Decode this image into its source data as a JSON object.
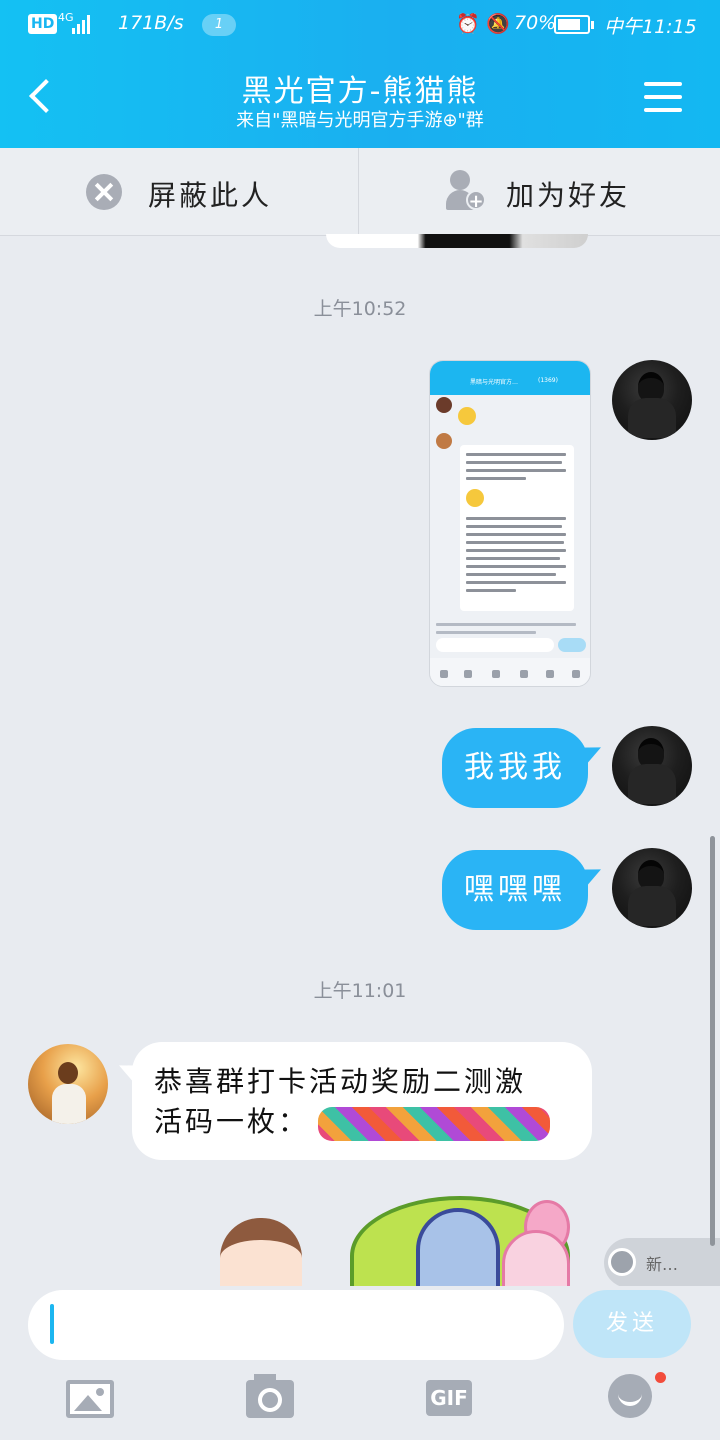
{
  "status_bar": {
    "hd": "HD",
    "network": "4G",
    "speed": "171B/s",
    "notif_count": "1",
    "battery": "70%",
    "time": "中午11:15"
  },
  "header": {
    "title": "黑光官方-熊猫熊",
    "subtitle": "来自\"黑暗与光明官方手游⊕\"群"
  },
  "actions": {
    "block_label": "屏蔽此人",
    "add_friend_label": "加为好友"
  },
  "messages": {
    "time1": "上午10:52",
    "me_text1": "我我我",
    "me_text2": "嘿嘿嘿",
    "time2": "上午11:01",
    "other_text_line1": "恭喜群打卡活动奖励二测激",
    "other_text_line2": "活码一枚："
  },
  "new_msg_tip": "新…",
  "composer": {
    "send_label": "发送",
    "gif_label": "GIF"
  },
  "colors": {
    "header": "#1aaff0",
    "my_bubble": "#2ab4f5",
    "background": "#e8ebf0",
    "send_button": "#bfe5f8"
  }
}
